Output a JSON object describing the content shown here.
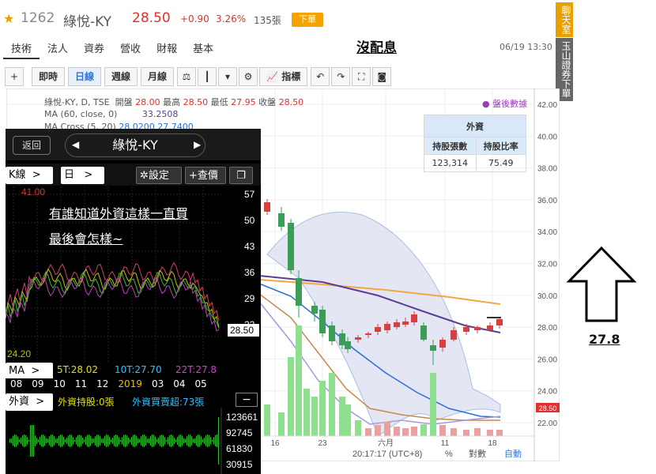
{
  "header": {
    "stock_code": "1262",
    "stock_name": "綠悅-KY",
    "price": "28.50",
    "change": "+0.90",
    "change_pct": "3.26%",
    "volume": "135張",
    "order_label": "下單",
    "no_dividend": "沒配息",
    "datetime": "06/19 13:30"
  },
  "nav_tabs": [
    "技術",
    "法人",
    "資券",
    "營收",
    "財報",
    "基本"
  ],
  "side_tabs": {
    "chat": "聊天室",
    "broker": "玉山證券下單"
  },
  "toolbar": {
    "periods": [
      "即時",
      "日線",
      "週線",
      "月線"
    ],
    "indicator_label": "指標"
  },
  "legend": {
    "line1": {
      "symbol": "綠悅-KY, D, TSE",
      "open_label": "開盤",
      "open": "28.00",
      "high_label": "最高",
      "high": "28.50",
      "low_label": "最低",
      "low": "27.95",
      "close_label": "收盤",
      "close": "28.50"
    },
    "line2": {
      "label": "MA (60, close, 0)",
      "value": "33.2508"
    },
    "line3": {
      "label": "MA Cross (5, 20)",
      "value": "28.0200  27.7400"
    },
    "after_hours": "盤後數據"
  },
  "foreign_table": {
    "title": "外資",
    "headers": [
      "持股張數",
      "持股比率"
    ],
    "values": [
      "123,314",
      "75.49"
    ]
  },
  "right_axis": {
    "ticks": [
      "42.00",
      "40.00",
      "38.00",
      "36.00",
      "34.00",
      "32.00",
      "30.00",
      "28.00",
      "26.00",
      "24.00",
      "22.00"
    ],
    "current": "28.50"
  },
  "bottom_axis": {
    "dates": [
      "16",
      "23",
      "六月",
      "11",
      "18"
    ],
    "time": "20:17:17 (UTC+8)",
    "pct": "%",
    "log": "對數",
    "auto": "自動"
  },
  "phone": {
    "back": "返回",
    "title": "綠悅-KY",
    "kline": "K線",
    "day": "日",
    "settings": "設定",
    "lookup": "+查價",
    "high_mark": "41.00",
    "low_mark": "24.20",
    "y_ticks": [
      "57",
      "50",
      "43",
      "36",
      "29",
      "22"
    ],
    "current": "28.50",
    "note_line1": "有誰知道外資這樣一直買",
    "note_line2": "最後會怎樣~",
    "ma_label": "MA",
    "ma5": "5T:28.02",
    "ma10": "10T:27.70",
    "ma22": "22T:27.8",
    "x_ticks": [
      "08",
      "09",
      "10",
      "11",
      "12",
      "2019",
      "03",
      "04",
      "05"
    ],
    "foreign_label": "外資",
    "foreign_hold": "外資持股:0張",
    "foreign_net": "外資買賣超:73張",
    "vol_ticks": [
      "123661",
      "92745",
      "61830",
      "30915"
    ]
  },
  "annotation": {
    "value": "27.8"
  }
}
